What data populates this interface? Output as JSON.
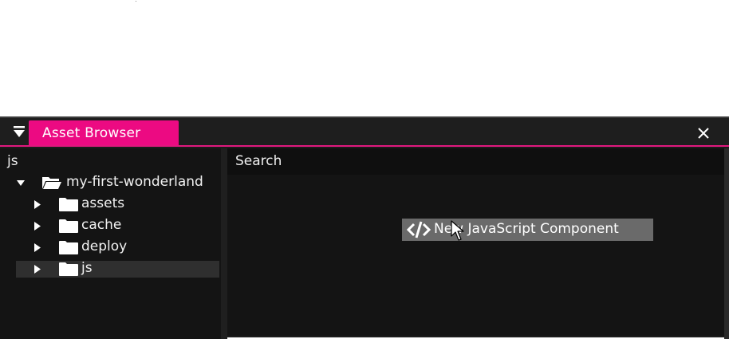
{
  "window": {
    "tab_title": "Asset Browser"
  },
  "tree": {
    "current_path": "js",
    "root": {
      "label": "my-first-wonderland",
      "expanded": true
    },
    "items": [
      {
        "label": "assets",
        "expanded": false,
        "selected": false
      },
      {
        "label": "cache",
        "expanded": false,
        "selected": false
      },
      {
        "label": "deploy",
        "expanded": false,
        "selected": false
      },
      {
        "label": "js",
        "expanded": false,
        "selected": true
      }
    ]
  },
  "content": {
    "search_label": "Search",
    "context_menu": {
      "items": [
        {
          "label": "New JavaScript Component",
          "icon": "code-icon"
        }
      ]
    }
  },
  "colors": {
    "accent": "#ec0a82",
    "background": "#141414",
    "menu_item": "#6a6a6a"
  }
}
